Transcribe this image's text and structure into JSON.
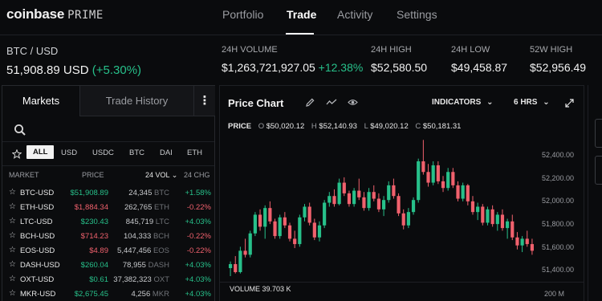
{
  "brand": {
    "name": "coinbase",
    "suffix": "PRIME"
  },
  "nav": {
    "portfolio": "Portfolio",
    "trade": "Trade",
    "activity": "Activity",
    "settings": "Settings"
  },
  "ticker": {
    "pair": "BTC / USD",
    "price": "51,908.89 USD",
    "change": "(+5.30%)",
    "volume_label": "24H VOLUME",
    "volume": "$1,263,721,927.05",
    "volume_change": "+12.38%",
    "high_label": "24H HIGH",
    "high": "$52,580.50",
    "low_label": "24H LOW",
    "low": "$49,458.87",
    "w52_label": "52W HIGH",
    "w52": "$52,956.49"
  },
  "markets": {
    "tab_markets": "Markets",
    "tab_history": "Trade History",
    "more": "⋮",
    "filters": [
      "ALL",
      "USD",
      "USDC",
      "BTC",
      "DAI",
      "ETH"
    ],
    "headers": {
      "market": "MARKET",
      "price": "PRICE",
      "vol": "24 VOL",
      "chg": "24 CHG"
    },
    "rows": [
      {
        "market": "BTC-USD",
        "price": "$51,908.89",
        "vol": "24,345",
        "cur": "BTC",
        "chg": "+1.58%",
        "up": true
      },
      {
        "market": "ETH-USD",
        "price": "$1,884.34",
        "vol": "262,765",
        "cur": "ETH",
        "chg": "-0.22%",
        "up": false
      },
      {
        "market": "LTC-USD",
        "price": "$230.43",
        "vol": "845,719",
        "cur": "LTC",
        "chg": "+4.03%",
        "up": true
      },
      {
        "market": "BCH-USD",
        "price": "$714.23",
        "vol": "104,333",
        "cur": "BCH",
        "chg": "-0.22%",
        "up": false
      },
      {
        "market": "EOS-USD",
        "price": "$4.89",
        "vol": "5,447,456",
        "cur": "EOS",
        "chg": "-0.22%",
        "up": false
      },
      {
        "market": "DASH-USD",
        "price": "$260.04",
        "vol": "78,955",
        "cur": "DASH",
        "chg": "+4.03%",
        "up": true
      },
      {
        "market": "OXT-USD",
        "price": "$0.61",
        "vol": "37,382,323",
        "cur": "OXT",
        "chg": "+4.03%",
        "up": true
      },
      {
        "market": "MKR-USD",
        "price": "$2,675.45",
        "vol": "4,256",
        "cur": "MKR",
        "chg": "+4.03%",
        "up": true
      }
    ]
  },
  "chart": {
    "title": "Price Chart",
    "indicators": "INDICATORS",
    "interval": "6 HRS",
    "ohlc_label": "PRICE",
    "o_key": "O",
    "o": "$50,020.12",
    "h_key": "H",
    "h": "$52,140.93",
    "l_key": "L",
    "l": "$49,020.12",
    "c_key": "C",
    "c": "$50,181.31",
    "yticks": [
      "52,400.00",
      "52,200.00",
      "52,000.00",
      "51,800.00",
      "51,600.00",
      "51,400.00"
    ],
    "volume_label": "VOLUME 39.703 K",
    "volume_axis": "200 M"
  },
  "colors": {
    "up": "#27c08a",
    "down": "#f0616d",
    "background": "#0a0b0d"
  },
  "chart_data": {
    "type": "candlestick",
    "title": "Price Chart",
    "y_ticks": [
      52400,
      52200,
      52000,
      51800,
      51600,
      51400
    ],
    "ylim": [
      51390,
      52460
    ],
    "candles": [
      [
        51480,
        51530,
        51420,
        51510
      ],
      [
        51510,
        51570,
        51440,
        51450
      ],
      [
        51450,
        51640,
        51440,
        51610
      ],
      [
        51610,
        51700,
        51560,
        51580
      ],
      [
        51580,
        51760,
        51560,
        51740
      ],
      [
        51740,
        51900,
        51720,
        51880
      ],
      [
        51880,
        51920,
        51760,
        51790
      ],
      [
        51790,
        51950,
        51700,
        51930
      ],
      [
        51930,
        51980,
        51810,
        51830
      ],
      [
        51830,
        51850,
        51700,
        51720
      ],
      [
        51720,
        51880,
        51700,
        51860
      ],
      [
        51860,
        51900,
        51780,
        51800
      ],
      [
        51800,
        51820,
        51680,
        51700
      ],
      [
        51700,
        51760,
        51630,
        51660
      ],
      [
        51660,
        51880,
        51640,
        51860
      ],
      [
        51860,
        51960,
        51830,
        51940
      ],
      [
        51940,
        51970,
        51800,
        51820
      ],
      [
        51820,
        51850,
        51690,
        51710
      ],
      [
        51710,
        51830,
        51680,
        51800
      ],
      [
        51800,
        51990,
        51780,
        51970
      ],
      [
        51970,
        52050,
        51940,
        52020
      ],
      [
        52020,
        52070,
        51940,
        51960
      ],
      [
        51960,
        52150,
        51950,
        52120
      ],
      [
        52120,
        52160,
        52020,
        52040
      ],
      [
        52040,
        52060,
        51940,
        51960
      ],
      [
        51960,
        52080,
        51940,
        52060
      ],
      [
        52060,
        52150,
        51990,
        52010
      ],
      [
        52010,
        52050,
        51910,
        51930
      ],
      [
        51930,
        52080,
        51910,
        52050
      ],
      [
        52050,
        52100,
        51980,
        52000
      ],
      [
        52000,
        52040,
        51900,
        51920
      ],
      [
        51920,
        52020,
        51870,
        51990
      ],
      [
        51990,
        52130,
        51970,
        52100
      ],
      [
        52100,
        52150,
        52000,
        52020
      ],
      [
        52020,
        52040,
        51870,
        51890
      ],
      [
        51890,
        51920,
        51770,
        51800
      ],
      [
        51800,
        51930,
        51780,
        51900
      ],
      [
        51900,
        52010,
        51880,
        51990
      ],
      [
        51990,
        52300,
        51970,
        52280
      ],
      [
        52280,
        52440,
        52180,
        52200
      ],
      [
        52200,
        52260,
        52090,
        52120
      ],
      [
        52120,
        52280,
        52100,
        52250
      ],
      [
        52250,
        52280,
        52110,
        52130
      ],
      [
        52130,
        52170,
        52050,
        52080
      ],
      [
        52080,
        52230,
        52060,
        52200
      ],
      [
        52200,
        52230,
        52080,
        52100
      ],
      [
        52100,
        52130,
        51980,
        52000
      ],
      [
        52000,
        52120,
        51980,
        52100
      ],
      [
        52100,
        52110,
        51950,
        51980
      ],
      [
        51980,
        52020,
        51880,
        51900
      ],
      [
        51900,
        51970,
        51840,
        51940
      ],
      [
        51940,
        51960,
        51800,
        51820
      ],
      [
        51820,
        51940,
        51800,
        51920
      ],
      [
        51920,
        51950,
        51790,
        51810
      ],
      [
        51810,
        51900,
        51760,
        51880
      ],
      [
        51880,
        51920,
        51760,
        51780
      ],
      [
        51780,
        51850,
        51700,
        51830
      ],
      [
        51830,
        51880,
        51690,
        51710
      ],
      [
        51710,
        51750,
        51620,
        51650
      ],
      [
        51650,
        51720,
        51600,
        51700
      ],
      [
        51700,
        51760,
        51640,
        51660
      ],
      [
        51660,
        51700,
        51580,
        51610
      ]
    ],
    "volume_axis_max": "200 M"
  }
}
